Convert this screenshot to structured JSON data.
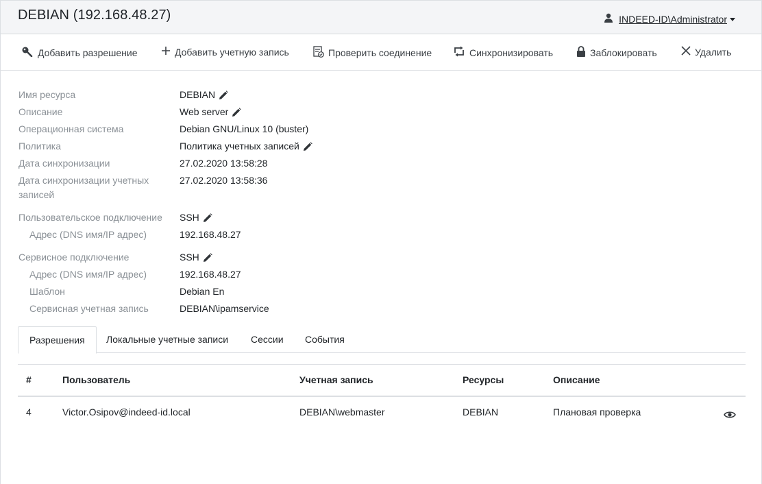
{
  "header": {
    "title": "DEBIAN (192.168.48.27)",
    "user": "INDEED-ID\\Administrator"
  },
  "toolbar": {
    "add_permission": "Добавить разрешение",
    "add_account": "Добавить учетную запись",
    "check_connection": "Проверить соединение",
    "synchronize": "Синхронизировать",
    "lock": "Заблокировать",
    "delete": "Удалить"
  },
  "properties": {
    "resource_name_label": "Имя ресурса",
    "resource_name": "DEBIAN",
    "description_label": "Описание",
    "description": "Web server",
    "os_label": "Операционная система",
    "os": "Debian GNU/Linux 10 (buster)",
    "policy_label": "Политика",
    "policy": "Политика учетных записей",
    "sync_date_label": "Дата синхронизации",
    "sync_date": "27.02.2020 13:58:28",
    "account_sync_date_label_1": "Дата синхронизации учетных",
    "account_sync_date_label_2": "записей",
    "account_sync_date": "27.02.2020 13:58:36",
    "user_connection_label": "Пользовательское подключение",
    "user_connection": "SSH",
    "user_address_label": "Адрес (DNS имя/IP адрес)",
    "user_address": "192.168.48.27",
    "service_connection_label": "Сервисное подключение",
    "service_connection": "SSH",
    "service_address_label": "Адрес (DNS имя/IP адрес)",
    "service_address": "192.168.48.27",
    "template_label": "Шаблон",
    "template": "Debian En",
    "service_account_label": "Сервисная учетная запись",
    "service_account": "DEBIAN\\ipamservice"
  },
  "tabs": [
    "Разрешения",
    "Локальные учетные записи",
    "Сессии",
    "События"
  ],
  "table": {
    "columns": [
      "#",
      "Пользователь",
      "Учетная запись",
      "Ресурсы",
      "Описание"
    ],
    "rows": [
      [
        "4",
        "Victor.Osipov@indeed-id.local",
        "DEBIAN\\webmaster",
        "DEBIAN",
        "Плановая проверка"
      ]
    ]
  },
  "icons": {
    "user": "user-icon",
    "edit": "pencil-icon",
    "view": "eye-icon"
  }
}
